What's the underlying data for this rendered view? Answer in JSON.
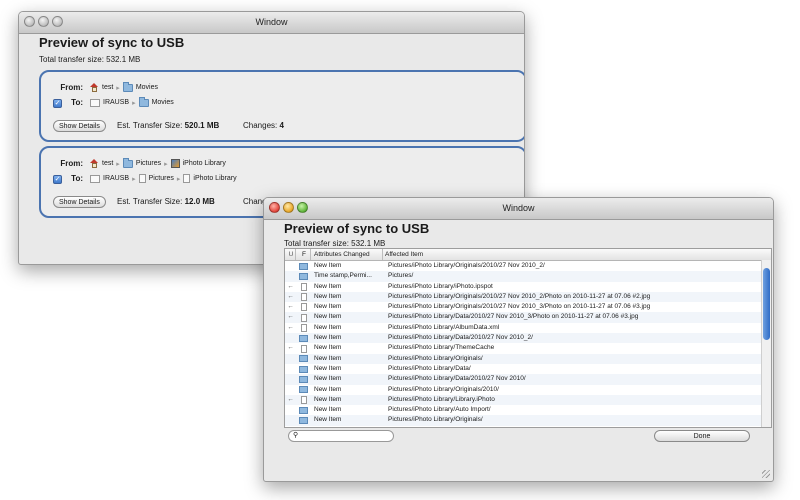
{
  "back_window": {
    "title": "Window",
    "heading": "Preview of sync to USB",
    "total": "Total transfer size: 532.1 MB",
    "groups": [
      {
        "from_label": "From:",
        "to_label": "To:",
        "from_path": [
          "test",
          "Movies"
        ],
        "to_path": [
          "IRAUSB",
          "Movies"
        ],
        "show_details": "Show Details",
        "est_label": "Est. Transfer Size:",
        "est_value": "520.1 MB",
        "changes_label": "Changes:",
        "changes_value": "4"
      },
      {
        "from_label": "From:",
        "to_label": "To:",
        "from_path": [
          "test",
          "Pictures",
          "iPhoto Library"
        ],
        "to_path": [
          "IRAUSB",
          "Pictures",
          "iPhoto Library"
        ],
        "show_details": "Show Details",
        "est_label": "Est. Transfer Size:",
        "est_value": "12.0 MB",
        "changes_label": "Chang"
      }
    ]
  },
  "front_window": {
    "title": "Window",
    "heading": "Preview of sync to USB",
    "total": "Total transfer size: 532.1 MB",
    "columns": [
      "U",
      "F",
      "Attributes Changed",
      "Affected Item"
    ],
    "rows": [
      {
        "u": "",
        "icon": "folder",
        "attr": "New Item",
        "item": "Pictures/iPhoto Library/Originals/2010/27 Nov 2010_2/"
      },
      {
        "u": "",
        "icon": "folder",
        "attr": "Time stamp,Permi...",
        "item": "Pictures/"
      },
      {
        "u": "←",
        "icon": "doc",
        "attr": "New Item",
        "item": "Pictures/iPhoto Library/iPhoto.ipspot"
      },
      {
        "u": "←",
        "icon": "doc",
        "attr": "New Item",
        "item": "Pictures/iPhoto Library/Originals/2010/27 Nov 2010_2/Photo on 2010-11-27 at 07.06 #2.jpg"
      },
      {
        "u": "←",
        "icon": "doc",
        "attr": "New Item",
        "item": "Pictures/iPhoto Library/Originals/2010/27 Nov 2010_3/Photo on 2010-11-27 at 07.06 #3.jpg"
      },
      {
        "u": "←",
        "icon": "doc",
        "attr": "New Item",
        "item": "Pictures/iPhoto Library/Data/2010/27 Nov 2010_3/Photo on 2010-11-27 at 07.06 #3.jpg"
      },
      {
        "u": "←",
        "icon": "doc",
        "attr": "New Item",
        "item": "Pictures/iPhoto Library/AlbumData.xml"
      },
      {
        "u": "",
        "icon": "folder",
        "attr": "New Item",
        "item": "Pictures/iPhoto Library/Data/2010/27 Nov 2010_2/"
      },
      {
        "u": "←",
        "icon": "doc",
        "attr": "New Item",
        "item": "Pictures/iPhoto Library/ThemeCache"
      },
      {
        "u": "",
        "icon": "folder",
        "attr": "New Item",
        "item": "Pictures/iPhoto Library/Originals/"
      },
      {
        "u": "",
        "icon": "folder",
        "attr": "New Item",
        "item": "Pictures/iPhoto Library/Data/"
      },
      {
        "u": "",
        "icon": "folder",
        "attr": "New Item",
        "item": "Pictures/iPhoto Library/Data/2010/27 Nov 2010/"
      },
      {
        "u": "",
        "icon": "folder",
        "attr": "New Item",
        "item": "Pictures/iPhoto Library/Originals/2010/"
      },
      {
        "u": "←",
        "icon": "doc",
        "attr": "New Item",
        "item": "Pictures/iPhoto Library/Library.iPhoto"
      },
      {
        "u": "",
        "icon": "folder",
        "attr": "New Item",
        "item": "Pictures/iPhoto Library/Auto Import/"
      },
      {
        "u": "",
        "icon": "folder",
        "attr": "New Item",
        "item": "Pictures/iPhoto Library/Originals/"
      }
    ],
    "search_placeholder": "",
    "done_label": "Done"
  }
}
